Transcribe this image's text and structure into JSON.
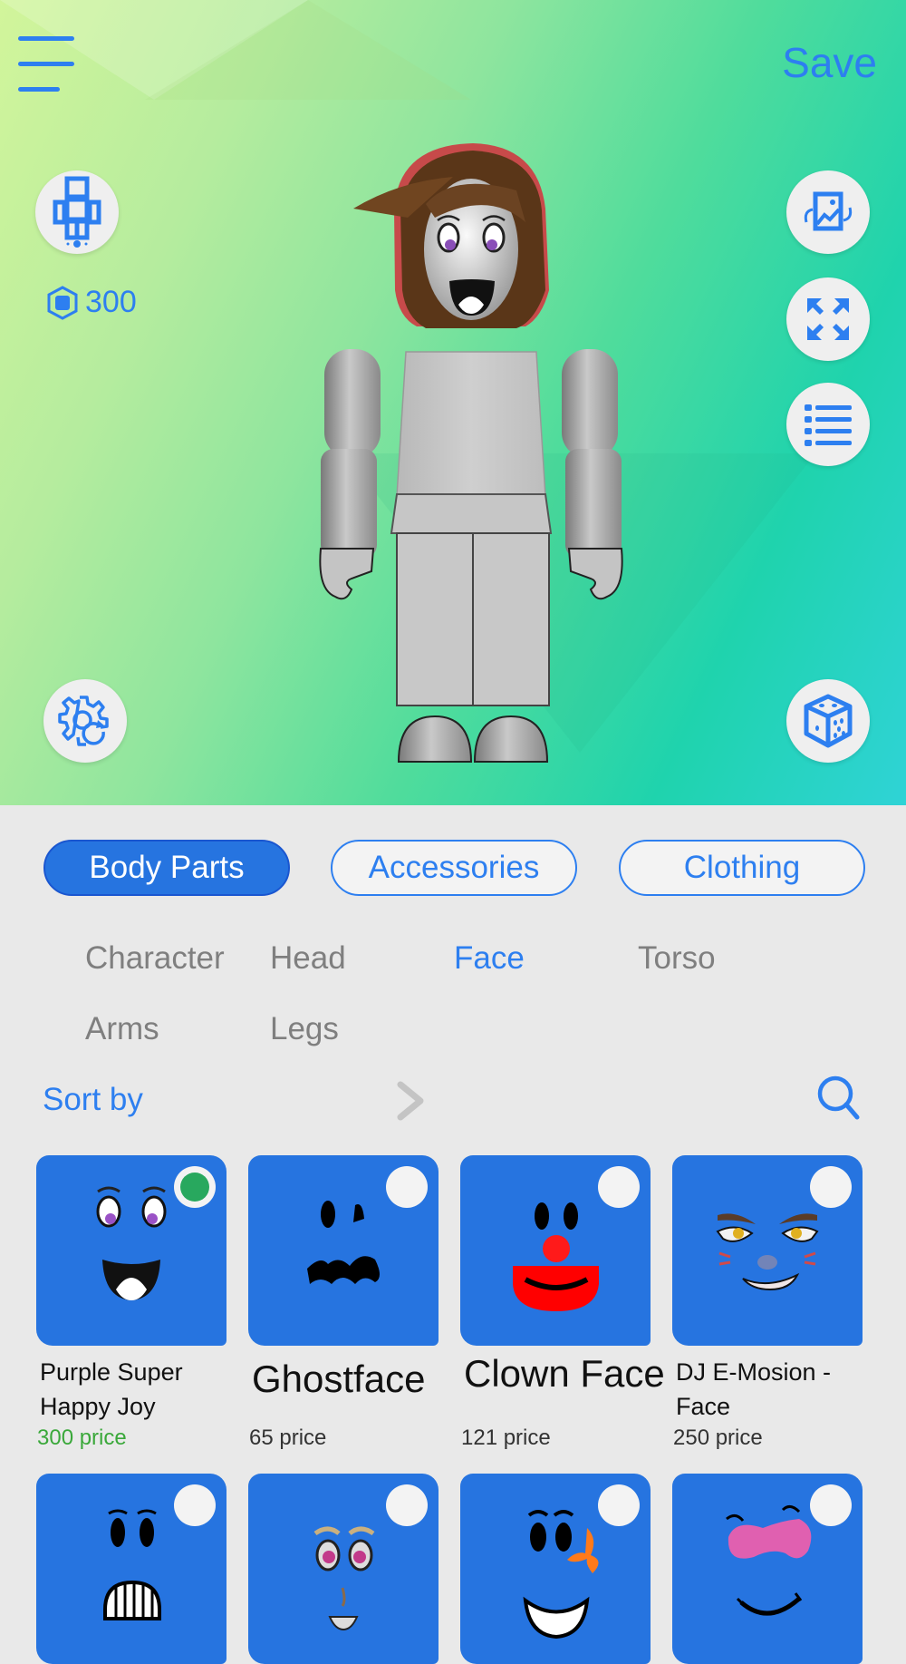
{
  "header": {
    "save_label": "Save",
    "robux_balance": "300"
  },
  "icons": {
    "menu": "hamburger-menu-icon",
    "avatar_type": "avatar-body-icon",
    "robux": "robux-hexagon-icon",
    "background": "rotate-background-image-icon",
    "fullscreen": "expand-arrows-icon",
    "list": "bulleted-list-icon",
    "settings": "gear-refresh-icon",
    "random": "dice-icon",
    "sort_chevron": "chevron-right-icon",
    "search": "search-icon"
  },
  "colors": {
    "accent": "#2d7ff0",
    "tab_active": "#2674e0",
    "tile": "#2674e0",
    "owned_price": "#3aa83a",
    "selected_dot": "#28a85e"
  },
  "main_tabs": [
    {
      "label": "Body Parts",
      "active": true
    },
    {
      "label": "Accessories",
      "active": false
    },
    {
      "label": "Clothing",
      "active": false
    }
  ],
  "sub_tabs": [
    {
      "label": "Character",
      "active": false
    },
    {
      "label": "Head",
      "active": false
    },
    {
      "label": "Face",
      "active": true
    },
    {
      "label": "Torso",
      "active": false
    },
    {
      "label": "Arms",
      "active": false
    },
    {
      "label": "Legs",
      "active": false
    }
  ],
  "sort": {
    "label": "Sort by"
  },
  "items": [
    {
      "name": "Purple Super Happy Joy",
      "price": "300 price",
      "selected": true,
      "owned": true
    },
    {
      "name": "Ghostface",
      "price": "65 price",
      "selected": false,
      "owned": false
    },
    {
      "name": "Clown Face",
      "price": "121 price",
      "selected": false,
      "owned": false
    },
    {
      "name": "DJ E-Mosion - Face",
      "price": "250 price",
      "selected": false,
      "owned": false
    },
    {
      "name": "",
      "price": "",
      "selected": false
    },
    {
      "name": "",
      "price": "",
      "selected": false
    },
    {
      "name": "",
      "price": "",
      "selected": false
    },
    {
      "name": "",
      "price": "",
      "selected": false
    }
  ]
}
